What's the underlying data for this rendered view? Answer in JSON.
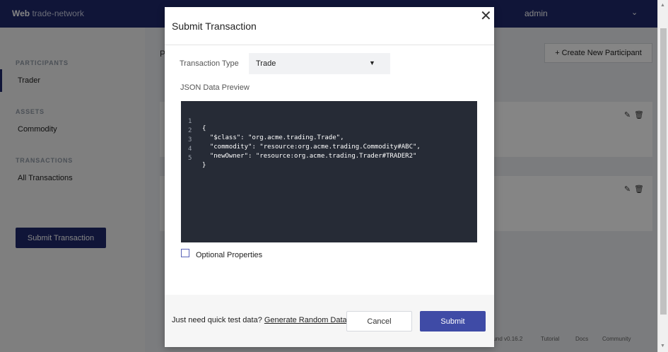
{
  "header": {
    "brand_bold": "Web",
    "brand_rest": "trade-network",
    "user": "admin"
  },
  "sidebar": {
    "participants_heading": "PARTICIPANTS",
    "trader_label": "Trader",
    "assets_heading": "ASSETS",
    "commodity_label": "Commodity",
    "transactions_heading": "TRANSACTIONS",
    "all_transactions_label": "All Transactions",
    "submit_label": "Submit Transaction"
  },
  "main": {
    "title_fragment": "P",
    "create_label": "+ Create New Participant",
    "footer_version": "ound v0.16.2",
    "footer_links": [
      "Tutorial",
      "Docs",
      "Community"
    ]
  },
  "modal": {
    "title": "Submit Transaction",
    "transaction_type_label": "Transaction Type",
    "transaction_type_value": "Trade",
    "json_preview_label": "JSON Data Preview",
    "json_lines": [
      {
        "no": "1",
        "code": "{"
      },
      {
        "no": "2",
        "code": "  \"$class\": \"org.acme.trading.Trade\","
      },
      {
        "no": "3",
        "code": "  \"commodity\": \"resource:org.acme.trading.Commodity#ABC\","
      },
      {
        "no": "4",
        "code": "  \"newOwner\": \"resource:org.acme.trading.Trader#TRADER2\""
      },
      {
        "no": "5",
        "code": "}"
      }
    ],
    "optional_properties_label": "Optional Properties",
    "optional_properties_checked": false,
    "quick_text": "Just need quick test data?",
    "generate_link": "Generate Random Data",
    "cancel_label": "Cancel",
    "submit_label": "Submit"
  },
  "icons": {
    "close": "close-icon",
    "chevron": "chevron-down-icon",
    "edit": "pencil-icon",
    "delete": "trash-icon"
  },
  "colors": {
    "topbar": "#1f2a6b",
    "submit_button": "#3f4ba6",
    "editor_bg": "#262b36"
  }
}
